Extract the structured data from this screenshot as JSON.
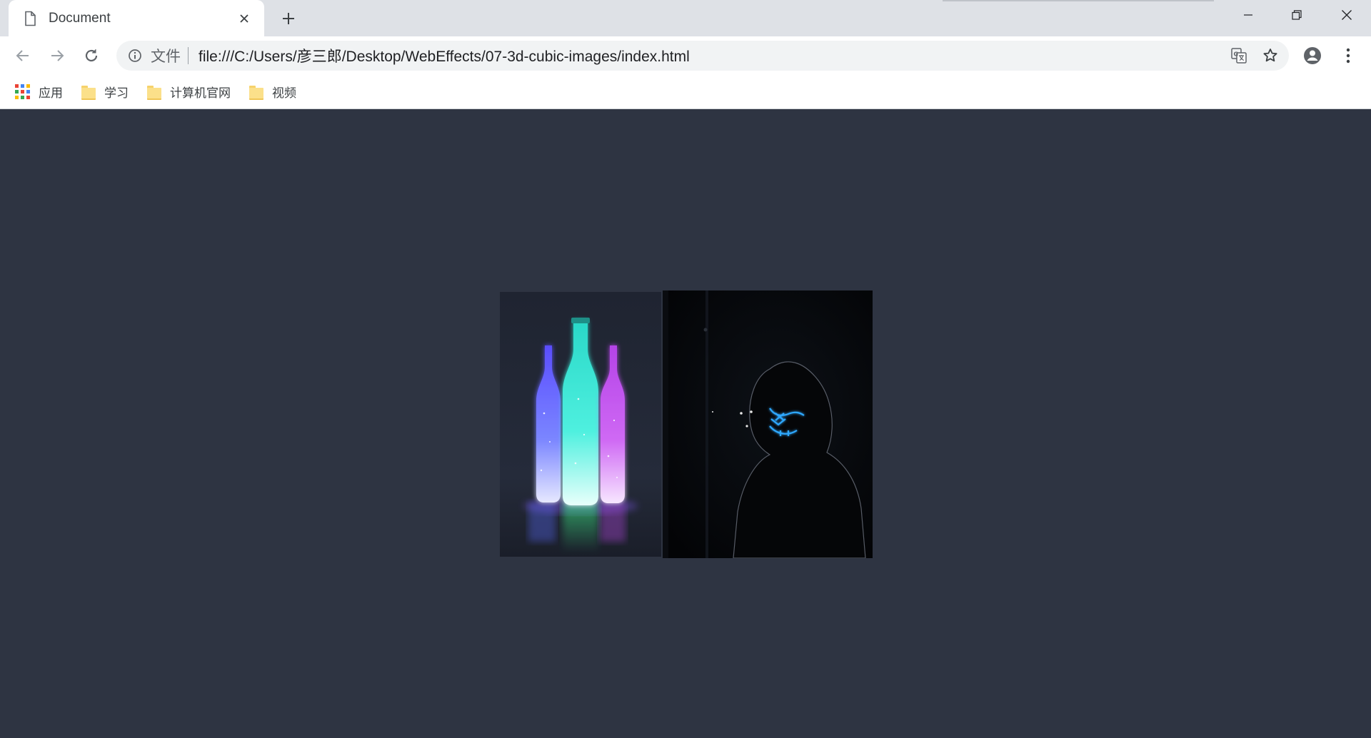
{
  "tab": {
    "title": "Document"
  },
  "omnibox": {
    "scheme_label": "文件",
    "url": "file:///C:/Users/彦三郎/Desktop/WebEffects/07-3d-cubic-images/index.html"
  },
  "bookmarks": [
    {
      "label": "应用",
      "icon": "apps-grid-icon"
    },
    {
      "label": "学习",
      "icon": "folder-icon"
    },
    {
      "label": "计算机官网",
      "icon": "folder-icon"
    },
    {
      "label": "视频",
      "icon": "folder-icon"
    }
  ],
  "icons": {
    "tab": "document-icon",
    "close": "close-icon",
    "new_tab": "plus-icon",
    "back": "arrow-left-icon",
    "forward": "arrow-right-icon",
    "reload": "reload-icon",
    "info": "info-icon",
    "translate": "translate-icon",
    "bookmark": "star-icon",
    "profile": "account-icon",
    "menu": "more-vert-icon"
  },
  "colors": {
    "page_background": "#2e3442",
    "tab_strip": "#dee1e6",
    "omnibox": "#f1f3f4",
    "folder": "#fbe08a"
  },
  "images": [
    {
      "name": "glowing-bottles-image",
      "description": "three neon glowing bottles: blue, cyan, purple"
    },
    {
      "name": "hooded-figure-image",
      "description": "hooded figure with blue neon mask in darkness"
    }
  ]
}
